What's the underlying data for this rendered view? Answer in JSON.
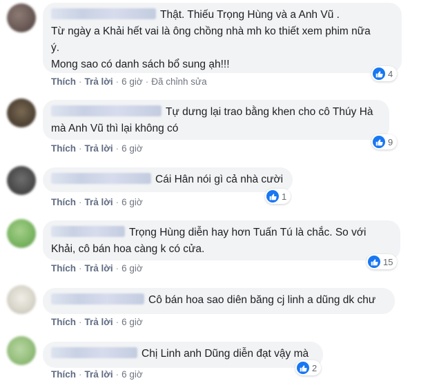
{
  "labels": {
    "like": "Thích",
    "reply": "Trả lời",
    "edited": "Đã chỉnh sửa",
    "dot": "·"
  },
  "comments": [
    {
      "text": "Thật. Thiếu Trọng Hùng và a Anh Vũ .\nTừ ngày a Khải hết vai là ông chồng nhà mh ko thiết xem phim nữa\ný.\nMong sao có danh sách bổ sung ạh!!!",
      "likes": "4",
      "time": "6 giờ",
      "edited": true
    },
    {
      "text": "Tự dưng lại trao bằng khen cho cô Thúy Hà\nmà Anh Vũ thì lại không có",
      "likes": "9",
      "time": "6 giờ",
      "edited": false
    },
    {
      "text": "Cái Hân nói gì cả nhà cười",
      "likes": "1",
      "time": "6 giờ",
      "edited": false
    },
    {
      "text": "Trọng Hùng diễn hay hơn Tuấn Tú là chắc. So với\nKhải, cô bán hoa càng k có cửa.",
      "likes": "15",
      "time": "6 giờ",
      "edited": false
    },
    {
      "text": "Cô bán hoa sao diên băng cj linh a dũng dk chư",
      "likes": "",
      "time": "6 giờ",
      "edited": false
    },
    {
      "text": "Chị Linh anh Dũng diễn đạt vậy mà",
      "likes": "2",
      "time": "6 giờ",
      "edited": false
    }
  ],
  "colors": {
    "accent": "#1877f2",
    "bubble": "#f2f3f5",
    "meta": "#65676b"
  },
  "icons": {
    "like": "thumbs-up-icon"
  }
}
